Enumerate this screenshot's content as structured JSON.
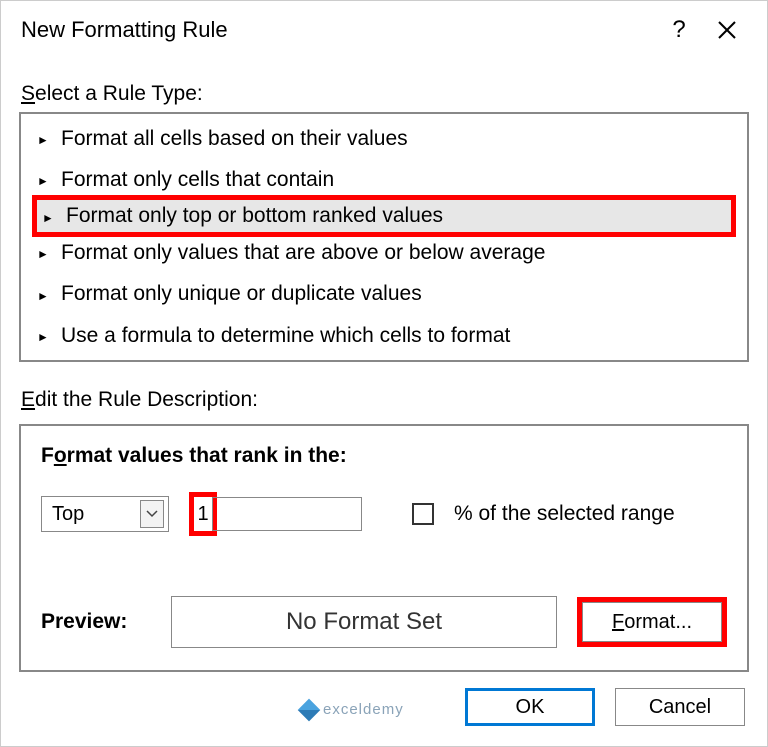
{
  "title": "New Formatting Rule",
  "select_label": "Select a Rule Type:",
  "rules": [
    "Format all cells based on their values",
    "Format only cells that contain",
    "Format only top or bottom ranked values",
    "Format only values that are above or below average",
    "Format only unique or duplicate values",
    "Use a formula to determine which cells to format"
  ],
  "selected_rule_index": 2,
  "edit_label": "Edit the Rule Description:",
  "rank_heading": "Format values that rank in the:",
  "combo_value": "Top",
  "rank_value": "1",
  "percent_label": "% of the selected range",
  "preview_label": "Preview:",
  "preview_text": "No Format Set",
  "format_btn": "Format...",
  "ok": "OK",
  "cancel": "Cancel",
  "watermark": "exceldemy"
}
